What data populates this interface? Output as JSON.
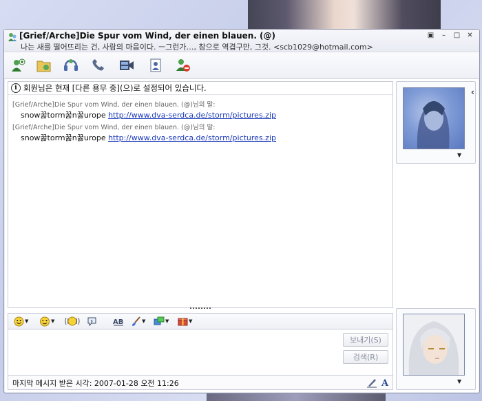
{
  "window": {
    "title": "[Grief/Arche]Die Spur vom Wind, der einen blauen. (@)",
    "subtitle": "나는 새를 떨어뜨리는 건, 사람의 마음이다. ㅡ그런가…, 참으로 역겹구만, 그것. <scb1029@hotmail.com>",
    "controls": [
      "restore-icon",
      "minimize-icon",
      "maximize-icon",
      "close-icon"
    ]
  },
  "toolbar": {
    "buttons": [
      "invite-contact-icon",
      "send-file-icon",
      "voice-call-icon",
      "phone-call-icon",
      "video-call-icon",
      "remote-assist-icon",
      "block-user-icon"
    ]
  },
  "chat": {
    "notice": "회원님은 현재 [다른 용무 중](으)로 설정되어 있습니다.",
    "messages": [
      {
        "header": "[Grief/Arche]Die Spur vom Wind, der einen blauen. (@)님의 말:",
        "prefix": "snow꿇torm꿇n꿇urope ",
        "link": "http://www.dva-serdca.de/storm/pictures.zip"
      },
      {
        "header": "[Grief/Arche]Die Spur vom Wind, der einen blauen. (@)님의 말:",
        "prefix": "snow꿇torm꿇n꿇urope ",
        "link": "http://www.dva-serdca.de/storm/pictures.zip"
      }
    ]
  },
  "input": {
    "send_label": "보내기(S)",
    "search_label": "검색(R)"
  },
  "status": {
    "last_message": "마지막 메시지 받은 시각: 2007-01-28 오전 11:26"
  },
  "colors": {
    "link": "#1a38b8",
    "frame_border": "#8f95a9"
  }
}
